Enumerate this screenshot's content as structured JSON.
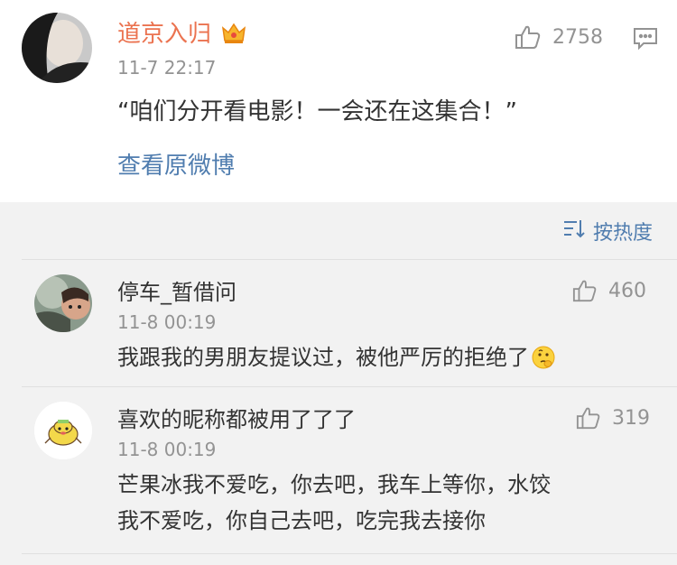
{
  "post": {
    "author": "道京入归",
    "time": "11-7 22:17",
    "likes": "2758",
    "text": "“咱们分开看电影！一会还在这集合！”",
    "view_original": "查看原微博"
  },
  "sort": {
    "label": "按热度"
  },
  "comments": [
    {
      "author": "停车_暂借问",
      "time": "11-8 00:19",
      "likes": "460",
      "text": "我跟我的男朋友提议过，被他严厉的拒绝了"
    },
    {
      "author": "喜欢的昵称都被用了了了",
      "time": "11-8 00:19",
      "likes": "319",
      "text_line1": "芒果冰我不爱吃，你去吧，我车上等你，水饺",
      "text_line2": "我不爱吃，你自己去吧，吃完我去接你"
    }
  ],
  "colors": {
    "accent_name": "#eb7350",
    "link": "#507daf",
    "muted": "#939393",
    "text": "#333333",
    "background": "#f2f2f2"
  },
  "icons": [
    "crown-icon",
    "thumbs-up-icon",
    "comment-icon",
    "sort-icon",
    "thinking-emoji-icon"
  ]
}
